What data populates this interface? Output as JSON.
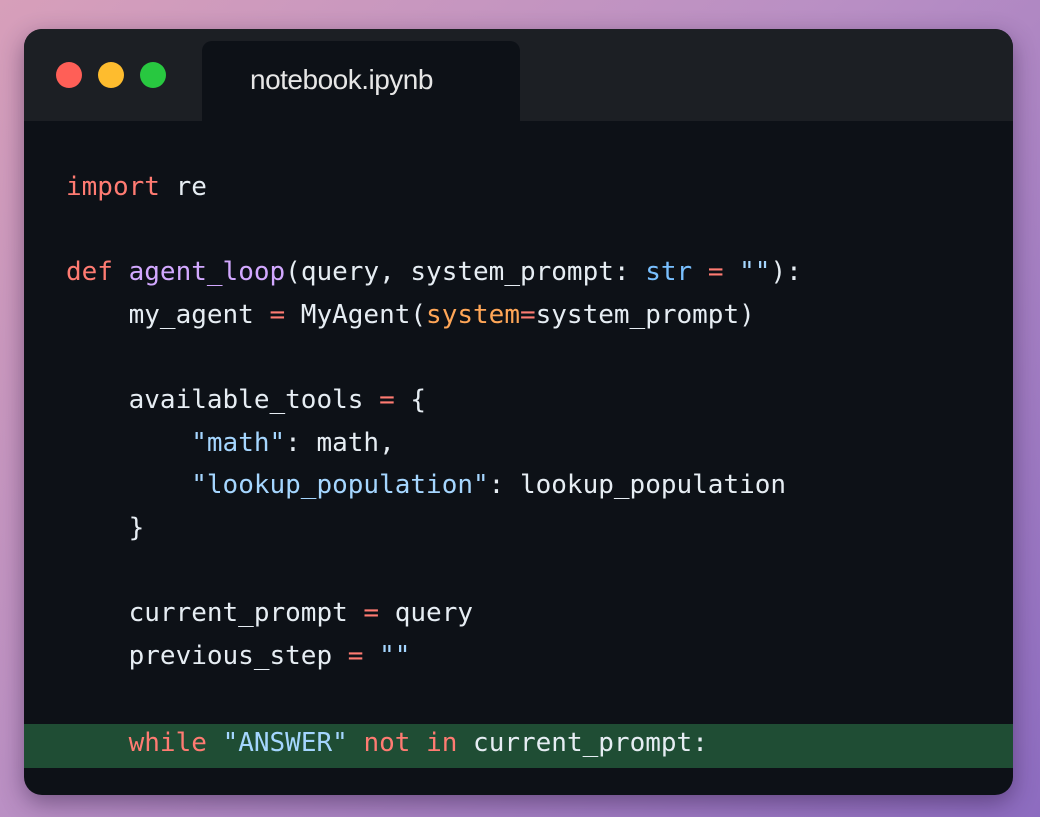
{
  "window": {
    "tab_title": "notebook.ipynb"
  },
  "code": {
    "lines": [
      [
        {
          "t": "import",
          "c": "kw"
        },
        {
          "t": " re",
          "c": "pl"
        }
      ],
      [],
      [
        {
          "t": "def",
          "c": "kw"
        },
        {
          "t": " ",
          "c": "pl"
        },
        {
          "t": "agent_loop",
          "c": "fn"
        },
        {
          "t": "(query, system_prompt: ",
          "c": "pl"
        },
        {
          "t": "str",
          "c": "ty"
        },
        {
          "t": " ",
          "c": "pl"
        },
        {
          "t": "=",
          "c": "op"
        },
        {
          "t": " ",
          "c": "pl"
        },
        {
          "t": "\"\"",
          "c": "str"
        },
        {
          "t": "):",
          "c": "pl"
        }
      ],
      [
        {
          "t": "    my_agent ",
          "c": "pl"
        },
        {
          "t": "=",
          "c": "op"
        },
        {
          "t": " MyAgent(",
          "c": "pl"
        },
        {
          "t": "system",
          "c": "prm"
        },
        {
          "t": "=",
          "c": "op"
        },
        {
          "t": "system_prompt)",
          "c": "pl"
        }
      ],
      [],
      [
        {
          "t": "    available_tools ",
          "c": "pl"
        },
        {
          "t": "=",
          "c": "op"
        },
        {
          "t": " {",
          "c": "pl"
        }
      ],
      [
        {
          "t": "        ",
          "c": "pl"
        },
        {
          "t": "\"math\"",
          "c": "str"
        },
        {
          "t": ": math,",
          "c": "pl"
        }
      ],
      [
        {
          "t": "        ",
          "c": "pl"
        },
        {
          "t": "\"lookup_population\"",
          "c": "str"
        },
        {
          "t": ": lookup_population",
          "c": "pl"
        }
      ],
      [
        {
          "t": "    }",
          "c": "pl"
        }
      ],
      [],
      [
        {
          "t": "    current_prompt ",
          "c": "pl"
        },
        {
          "t": "=",
          "c": "op"
        },
        {
          "t": " query",
          "c": "pl"
        }
      ],
      [
        {
          "t": "    previous_step ",
          "c": "pl"
        },
        {
          "t": "=",
          "c": "op"
        },
        {
          "t": " ",
          "c": "pl"
        },
        {
          "t": "\"\"",
          "c": "str"
        }
      ],
      [],
      [
        {
          "t": "    ",
          "c": "pl"
        },
        {
          "t": "while",
          "c": "kw"
        },
        {
          "t": " ",
          "c": "pl"
        },
        {
          "t": "\"ANSWER\"",
          "c": "str"
        },
        {
          "t": " ",
          "c": "pl"
        },
        {
          "t": "not",
          "c": "kw"
        },
        {
          "t": " ",
          "c": "pl"
        },
        {
          "t": "in",
          "c": "kw"
        },
        {
          "t": " current_prompt:",
          "c": "pl"
        }
      ]
    ],
    "highlighted_line": 14
  }
}
